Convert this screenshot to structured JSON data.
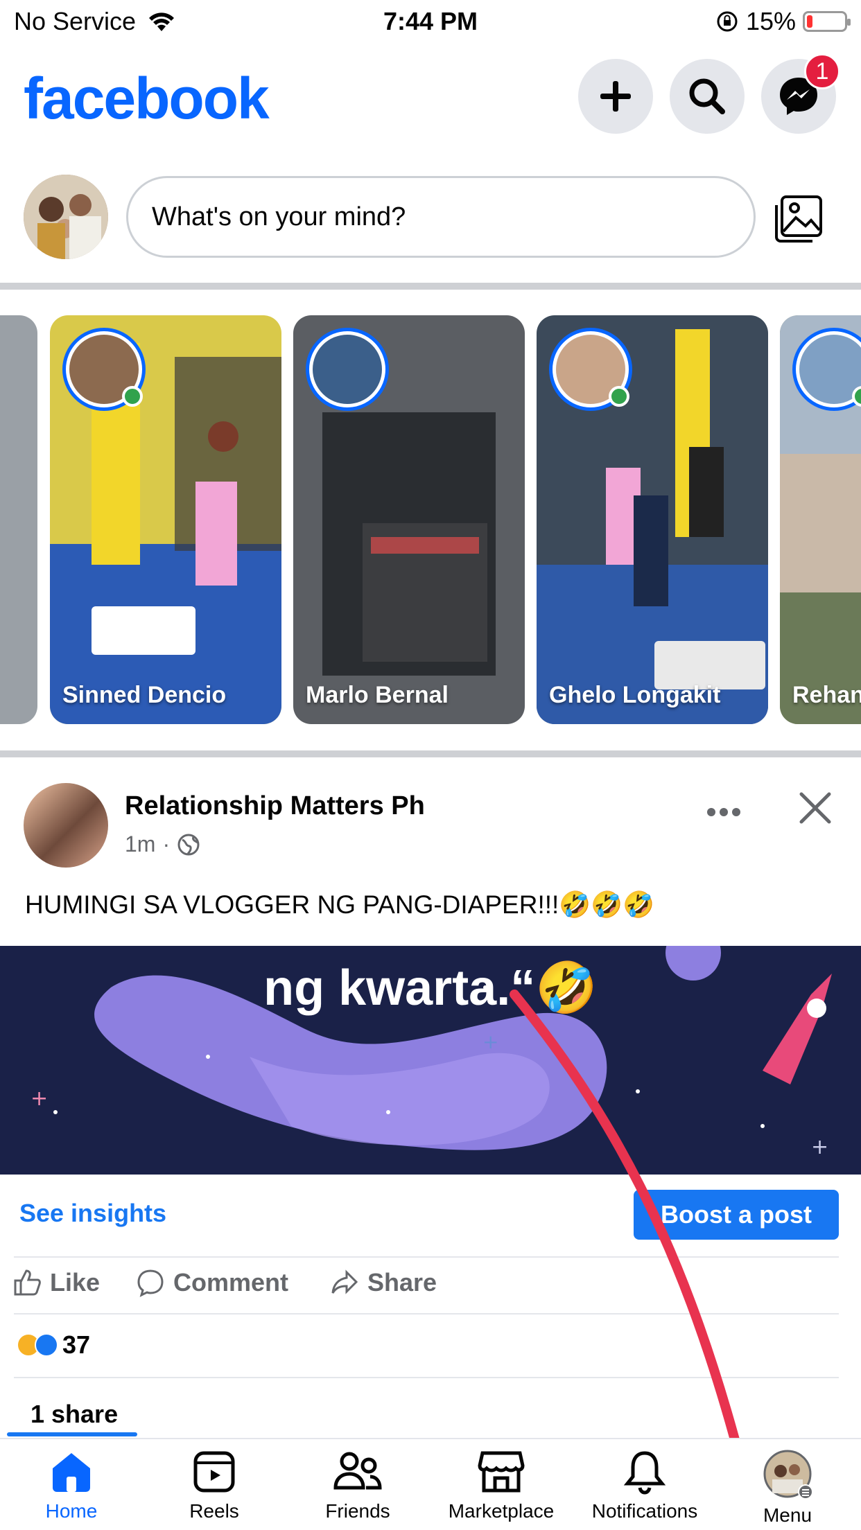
{
  "status_bar": {
    "carrier": "No Service",
    "time": "7:44 PM",
    "battery": "15%",
    "battery_level": 0.15
  },
  "header": {
    "logo": "facebook",
    "messenger_badge": "1"
  },
  "composer": {
    "placeholder": "What's on your mind?"
  },
  "stories": [
    {
      "name": "Sinned Dencio",
      "online": true,
      "bg": "#d9c94a"
    },
    {
      "name": "Marlo Bernal",
      "online": false,
      "bg": "#5b5e63"
    },
    {
      "name": "Ghelo Longakit",
      "online": true,
      "bg": "#2f5aa8"
    },
    {
      "name": "Rehan",
      "online": true,
      "bg": "#8a8f6a"
    }
  ],
  "post": {
    "author": "Relationship Matters Ph",
    "time": "1m",
    "text": "HUMINGI SA VLOGGER NG PANG-DIAPER!!!🤣🤣🤣",
    "image": {
      "headline": "ng kwarta.“🤣",
      "see_insights": "See insights",
      "boost": "Boost a post",
      "like": "Like",
      "comment": "Comment",
      "share": "Share",
      "reaction_count": "37",
      "shares": "1 share"
    }
  },
  "bottom_nav": {
    "home": "Home",
    "reels": "Reels",
    "friends": "Friends",
    "marketplace": "Marketplace",
    "notifications": "Notifications",
    "menu": "Menu"
  },
  "colors": {
    "brand_blue": "#0866ff",
    "badge_red": "#e41e3f",
    "online_green": "#31a24c"
  }
}
